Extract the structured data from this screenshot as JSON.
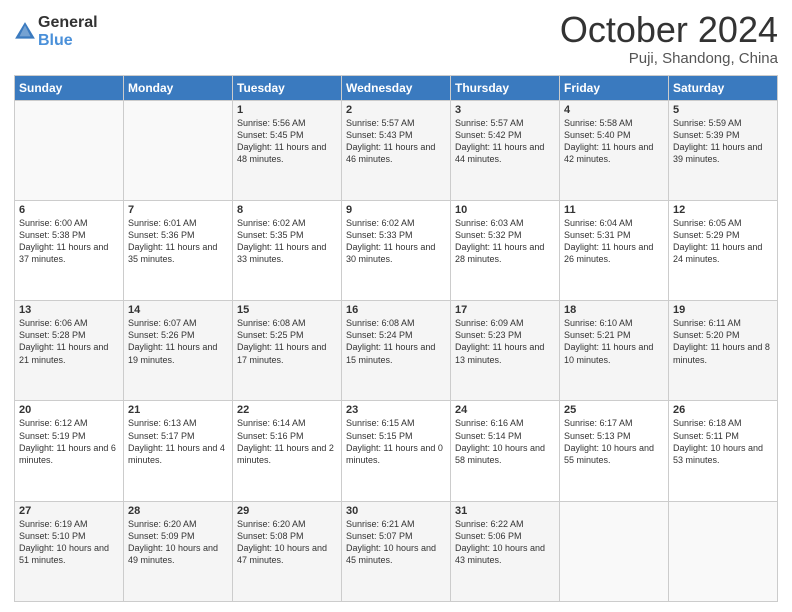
{
  "header": {
    "logo": {
      "line1": "General",
      "line2": "Blue"
    },
    "title": "October 2024",
    "location": "Puji, Shandong, China"
  },
  "weekdays": [
    "Sunday",
    "Monday",
    "Tuesday",
    "Wednesday",
    "Thursday",
    "Friday",
    "Saturday"
  ],
  "weeks": [
    [
      {
        "day": "",
        "info": ""
      },
      {
        "day": "",
        "info": ""
      },
      {
        "day": "1",
        "info": "Sunrise: 5:56 AM\nSunset: 5:45 PM\nDaylight: 11 hours and 48 minutes."
      },
      {
        "day": "2",
        "info": "Sunrise: 5:57 AM\nSunset: 5:43 PM\nDaylight: 11 hours and 46 minutes."
      },
      {
        "day": "3",
        "info": "Sunrise: 5:57 AM\nSunset: 5:42 PM\nDaylight: 11 hours and 44 minutes."
      },
      {
        "day": "4",
        "info": "Sunrise: 5:58 AM\nSunset: 5:40 PM\nDaylight: 11 hours and 42 minutes."
      },
      {
        "day": "5",
        "info": "Sunrise: 5:59 AM\nSunset: 5:39 PM\nDaylight: 11 hours and 39 minutes."
      }
    ],
    [
      {
        "day": "6",
        "info": "Sunrise: 6:00 AM\nSunset: 5:38 PM\nDaylight: 11 hours and 37 minutes."
      },
      {
        "day": "7",
        "info": "Sunrise: 6:01 AM\nSunset: 5:36 PM\nDaylight: 11 hours and 35 minutes."
      },
      {
        "day": "8",
        "info": "Sunrise: 6:02 AM\nSunset: 5:35 PM\nDaylight: 11 hours and 33 minutes."
      },
      {
        "day": "9",
        "info": "Sunrise: 6:02 AM\nSunset: 5:33 PM\nDaylight: 11 hours and 30 minutes."
      },
      {
        "day": "10",
        "info": "Sunrise: 6:03 AM\nSunset: 5:32 PM\nDaylight: 11 hours and 28 minutes."
      },
      {
        "day": "11",
        "info": "Sunrise: 6:04 AM\nSunset: 5:31 PM\nDaylight: 11 hours and 26 minutes."
      },
      {
        "day": "12",
        "info": "Sunrise: 6:05 AM\nSunset: 5:29 PM\nDaylight: 11 hours and 24 minutes."
      }
    ],
    [
      {
        "day": "13",
        "info": "Sunrise: 6:06 AM\nSunset: 5:28 PM\nDaylight: 11 hours and 21 minutes."
      },
      {
        "day": "14",
        "info": "Sunrise: 6:07 AM\nSunset: 5:26 PM\nDaylight: 11 hours and 19 minutes."
      },
      {
        "day": "15",
        "info": "Sunrise: 6:08 AM\nSunset: 5:25 PM\nDaylight: 11 hours and 17 minutes."
      },
      {
        "day": "16",
        "info": "Sunrise: 6:08 AM\nSunset: 5:24 PM\nDaylight: 11 hours and 15 minutes."
      },
      {
        "day": "17",
        "info": "Sunrise: 6:09 AM\nSunset: 5:23 PM\nDaylight: 11 hours and 13 minutes."
      },
      {
        "day": "18",
        "info": "Sunrise: 6:10 AM\nSunset: 5:21 PM\nDaylight: 11 hours and 10 minutes."
      },
      {
        "day": "19",
        "info": "Sunrise: 6:11 AM\nSunset: 5:20 PM\nDaylight: 11 hours and 8 minutes."
      }
    ],
    [
      {
        "day": "20",
        "info": "Sunrise: 6:12 AM\nSunset: 5:19 PM\nDaylight: 11 hours and 6 minutes."
      },
      {
        "day": "21",
        "info": "Sunrise: 6:13 AM\nSunset: 5:17 PM\nDaylight: 11 hours and 4 minutes."
      },
      {
        "day": "22",
        "info": "Sunrise: 6:14 AM\nSunset: 5:16 PM\nDaylight: 11 hours and 2 minutes."
      },
      {
        "day": "23",
        "info": "Sunrise: 6:15 AM\nSunset: 5:15 PM\nDaylight: 11 hours and 0 minutes."
      },
      {
        "day": "24",
        "info": "Sunrise: 6:16 AM\nSunset: 5:14 PM\nDaylight: 10 hours and 58 minutes."
      },
      {
        "day": "25",
        "info": "Sunrise: 6:17 AM\nSunset: 5:13 PM\nDaylight: 10 hours and 55 minutes."
      },
      {
        "day": "26",
        "info": "Sunrise: 6:18 AM\nSunset: 5:11 PM\nDaylight: 10 hours and 53 minutes."
      }
    ],
    [
      {
        "day": "27",
        "info": "Sunrise: 6:19 AM\nSunset: 5:10 PM\nDaylight: 10 hours and 51 minutes."
      },
      {
        "day": "28",
        "info": "Sunrise: 6:20 AM\nSunset: 5:09 PM\nDaylight: 10 hours and 49 minutes."
      },
      {
        "day": "29",
        "info": "Sunrise: 6:20 AM\nSunset: 5:08 PM\nDaylight: 10 hours and 47 minutes."
      },
      {
        "day": "30",
        "info": "Sunrise: 6:21 AM\nSunset: 5:07 PM\nDaylight: 10 hours and 45 minutes."
      },
      {
        "day": "31",
        "info": "Sunrise: 6:22 AM\nSunset: 5:06 PM\nDaylight: 10 hours and 43 minutes."
      },
      {
        "day": "",
        "info": ""
      },
      {
        "day": "",
        "info": ""
      }
    ]
  ]
}
